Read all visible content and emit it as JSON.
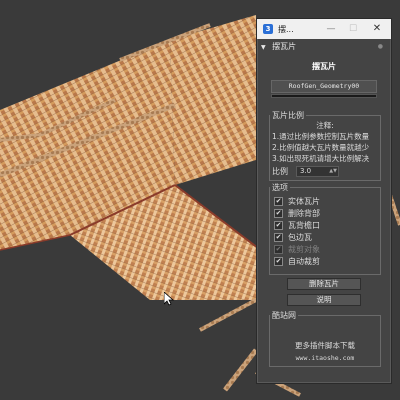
{
  "window": {
    "title": "摆...",
    "app_icon": "3ds-max-icon",
    "min_glyph": "—",
    "max_glyph": "☐",
    "close_glyph": "✕"
  },
  "rollout": {
    "header": "摆瓦片",
    "collapse_glyph": "▼",
    "pin_glyph": "●",
    "title": "摆瓦片",
    "geometry_button": "RoofGen_Geometry00"
  },
  "ratio_group": {
    "label": "瓦片比例",
    "note_title": "注释:",
    "notes": [
      "1.通过比例参数控制瓦片数量",
      "2.比例值越大瓦片数量就越少",
      "3.如出现死机请增大比例解决"
    ],
    "ratio_label": "比例",
    "ratio_value": "3.0"
  },
  "options_group": {
    "label": "选项",
    "items": [
      {
        "label": "实体瓦片",
        "checked": true,
        "enabled": true
      },
      {
        "label": "删除背部",
        "checked": true,
        "enabled": true
      },
      {
        "label": "瓦背檐口",
        "checked": true,
        "enabled": true
      },
      {
        "label": "包边瓦",
        "checked": true,
        "enabled": true
      },
      {
        "label": "裁剪对象",
        "checked": true,
        "enabled": false
      },
      {
        "label": "自动裁剪",
        "checked": true,
        "enabled": true
      }
    ]
  },
  "buttons": {
    "delete": "删除瓦片",
    "help": "说明"
  },
  "cool_group": {
    "label": "酷站网",
    "more_scripts": "更多插件脚本下载",
    "url": "www.itaoshe.com"
  },
  "colors": {
    "tile_orange": "#d49a5c",
    "tile_light": "#e8c29a",
    "ridge_red": "#8a3b2a",
    "panel_bg": "#444444",
    "viewport_bg": "#3a3a3a"
  }
}
